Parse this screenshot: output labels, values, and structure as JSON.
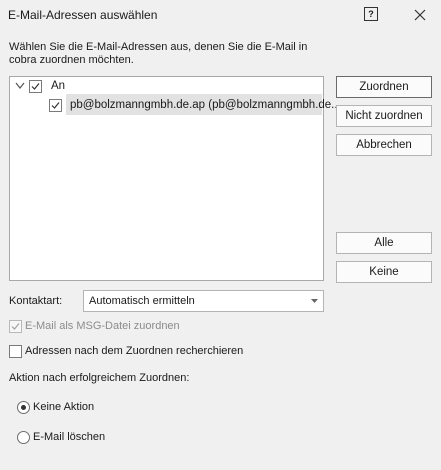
{
  "window": {
    "title": "E-Mail-Adressen auswählen",
    "help_glyph": "?"
  },
  "instructions": "Wählen Sie die E-Mail-Adressen aus, denen Sie die E-Mail in cobra zuordnen möchten.",
  "tree": {
    "root": {
      "label": "An",
      "checked": true,
      "expanded": true
    },
    "children": [
      {
        "label": "pb@bolzmanngmbh.de.ap (pb@bolzmanngmbh.de...",
        "checked": true,
        "selected": true
      }
    ]
  },
  "buttons": {
    "zuordnen": "Zuordnen",
    "nicht_zuordnen": "Nicht zuordnen",
    "abbrechen": "Abbrechen",
    "alle": "Alle",
    "keine": "Keine"
  },
  "kontaktart": {
    "label": "Kontaktart:",
    "value": "Automatisch ermitteln"
  },
  "options": {
    "msg_datei": {
      "label": "E-Mail als MSG-Datei zuordnen",
      "checked": true,
      "disabled": true
    },
    "recherchieren": {
      "label": "Adressen nach dem Zuordnen recherchieren",
      "checked": false
    }
  },
  "aktion": {
    "label": "Aktion nach erfolgreichem Zuordnen:",
    "choices": [
      {
        "label": "Keine Aktion",
        "selected": true
      },
      {
        "label": "E-Mail löschen",
        "selected": false
      }
    ]
  }
}
